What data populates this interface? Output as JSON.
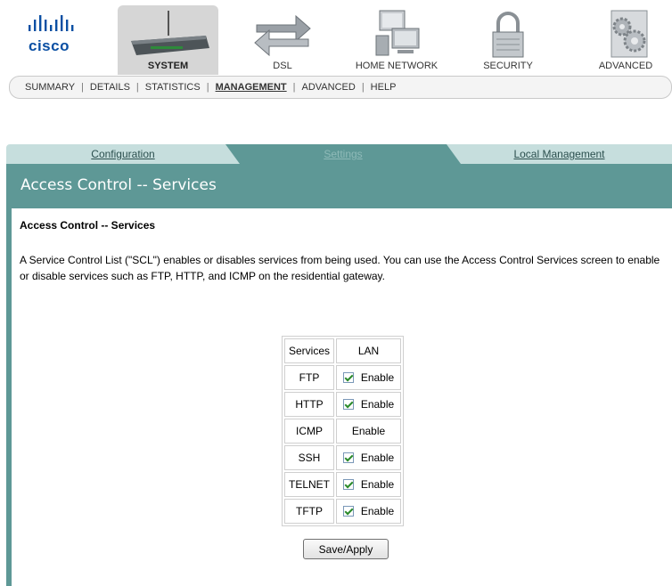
{
  "header": {
    "logo_text": "cisco",
    "nav": [
      {
        "label": "SYSTEM",
        "icon": "router-icon",
        "active": true
      },
      {
        "label": "DSL",
        "icon": "dsl-arrows-icon",
        "active": false
      },
      {
        "label": "HOME NETWORK",
        "icon": "computers-icon",
        "active": false
      },
      {
        "label": "SECURITY",
        "icon": "padlock-icon",
        "active": false
      },
      {
        "label": "ADVANCED",
        "icon": "gears-icon",
        "active": false
      }
    ],
    "subnav": [
      {
        "label": "SUMMARY",
        "active": false
      },
      {
        "label": "DETAILS",
        "active": false
      },
      {
        "label": "STATISTICS",
        "active": false
      },
      {
        "label": "MANAGEMENT",
        "active": true
      },
      {
        "label": "ADVANCED",
        "active": false
      },
      {
        "label": "HELP",
        "active": false
      }
    ]
  },
  "tabs": [
    {
      "label": "Configuration",
      "active": false
    },
    {
      "label": "Settings",
      "active": true
    },
    {
      "label": "Local Management",
      "active": false
    }
  ],
  "page": {
    "title": "Access Control -- Services",
    "section_title": "Access Control -- Services",
    "description": "A Service Control List (\"SCL\") enables or disables services from being used. You can use the Access Control Services screen to enable or disable services such as FTP, HTTP, and ICMP on the residential gateway."
  },
  "services_table": {
    "headers": [
      "Services",
      "LAN"
    ],
    "rows": [
      {
        "service": "FTP",
        "option": "Enable",
        "has_checkbox": true,
        "checked": true
      },
      {
        "service": "HTTP",
        "option": "Enable",
        "has_checkbox": true,
        "checked": true
      },
      {
        "service": "ICMP",
        "option": "Enable",
        "has_checkbox": false,
        "checked": false
      },
      {
        "service": "SSH",
        "option": "Enable",
        "has_checkbox": true,
        "checked": true
      },
      {
        "service": "TELNET",
        "option": "Enable",
        "has_checkbox": true,
        "checked": true
      },
      {
        "service": "TFTP",
        "option": "Enable",
        "has_checkbox": true,
        "checked": true
      }
    ]
  },
  "save_button": "Save/Apply",
  "colors": {
    "teal_dark": "#5e9896",
    "teal_light": "#c6dedd",
    "cisco_blue": "#0a4fa3"
  }
}
